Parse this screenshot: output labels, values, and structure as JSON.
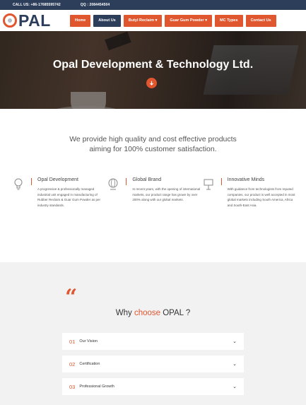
{
  "topbar": {
    "call": "CALL US: +86-17685595742",
    "qq": "QQ : 2084454504"
  },
  "logo": {
    "text": "PAL"
  },
  "nav": [
    {
      "label": "Home"
    },
    {
      "label": "About Us"
    },
    {
      "label": "Butyl Reclaim ▾"
    },
    {
      "label": "Guar Gum Powder ▾"
    },
    {
      "label": "MC Types"
    },
    {
      "label": "Contact Us"
    }
  ],
  "hero": {
    "title": "Opal Development & Technology Ltd.",
    "button_icon": "arrow-down-icon"
  },
  "tagline": {
    "line1": "We provide high quality and cost effective products",
    "line2": "aiming for 100% customer satisfaction."
  },
  "features": [
    {
      "icon": "lightbulb-icon",
      "title": "Opal Development",
      "text": "A progressive & professionally managed industrial unit engaged in manufacturing of Rubber Reclaim & Guar Gum Powder as per industry standards."
    },
    {
      "icon": "globe-icon",
      "title": "Global Brand",
      "text": "In recent years, with the opening of international markets, our product range has grown by over 200% along with our global markets."
    },
    {
      "icon": "board-icon",
      "title": "Innovative Minds",
      "text": "With guidance from technologists from reputed companies, our product is well accepted in most global markets including South America, Africa and South-East Asia."
    }
  ],
  "why": {
    "title_prefix": "Why ",
    "title_accent": "choose",
    "title_suffix": " OPAL ?"
  },
  "accordion": [
    {
      "num": "01",
      "label": "Our Vision"
    },
    {
      "num": "02",
      "label": "Certification"
    },
    {
      "num": "03",
      "label": "Professional Growth"
    }
  ],
  "colors": {
    "accent": "#e0562f",
    "navy": "#2c3e5a"
  }
}
